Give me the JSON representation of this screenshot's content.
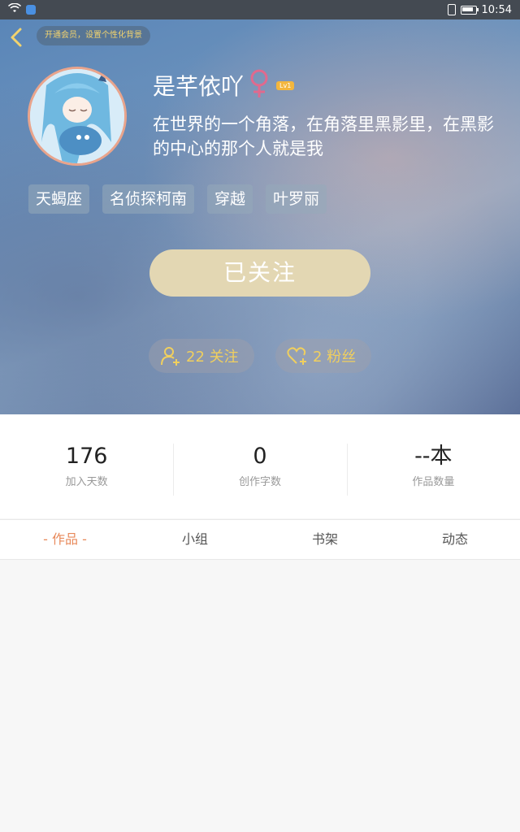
{
  "status_bar": {
    "time": "10:54"
  },
  "header": {
    "vip_prompt": "开通会员，设置个性化背景",
    "username": "是芊依吖",
    "gender_symbol": "♀",
    "level": "Lv1",
    "signature": "在世界的一个角落，在角落里黑影里，在黑影的中心的那个人就是我",
    "tags": [
      "天蝎座",
      "名侦探柯南",
      "穿越",
      "叶罗丽"
    ],
    "follow_button": "已关注",
    "following_label": "22 关注",
    "fans_label": "2 粉丝"
  },
  "stats": [
    {
      "value": "176",
      "label": "加入天数"
    },
    {
      "value": "0",
      "label": "创作字数"
    },
    {
      "value": "--本",
      "label": "作品数量"
    }
  ],
  "tabs": [
    {
      "label": "- 作品 -",
      "active": true
    },
    {
      "label": "小组",
      "active": false
    },
    {
      "label": "书架",
      "active": false
    },
    {
      "label": "动态",
      "active": false
    }
  ],
  "colors": {
    "accent_gold": "#f0cf5e",
    "follow_button_bg": "#e3d7b3",
    "active_tab": "#e8895a",
    "gender_pink": "#e06a8e"
  }
}
